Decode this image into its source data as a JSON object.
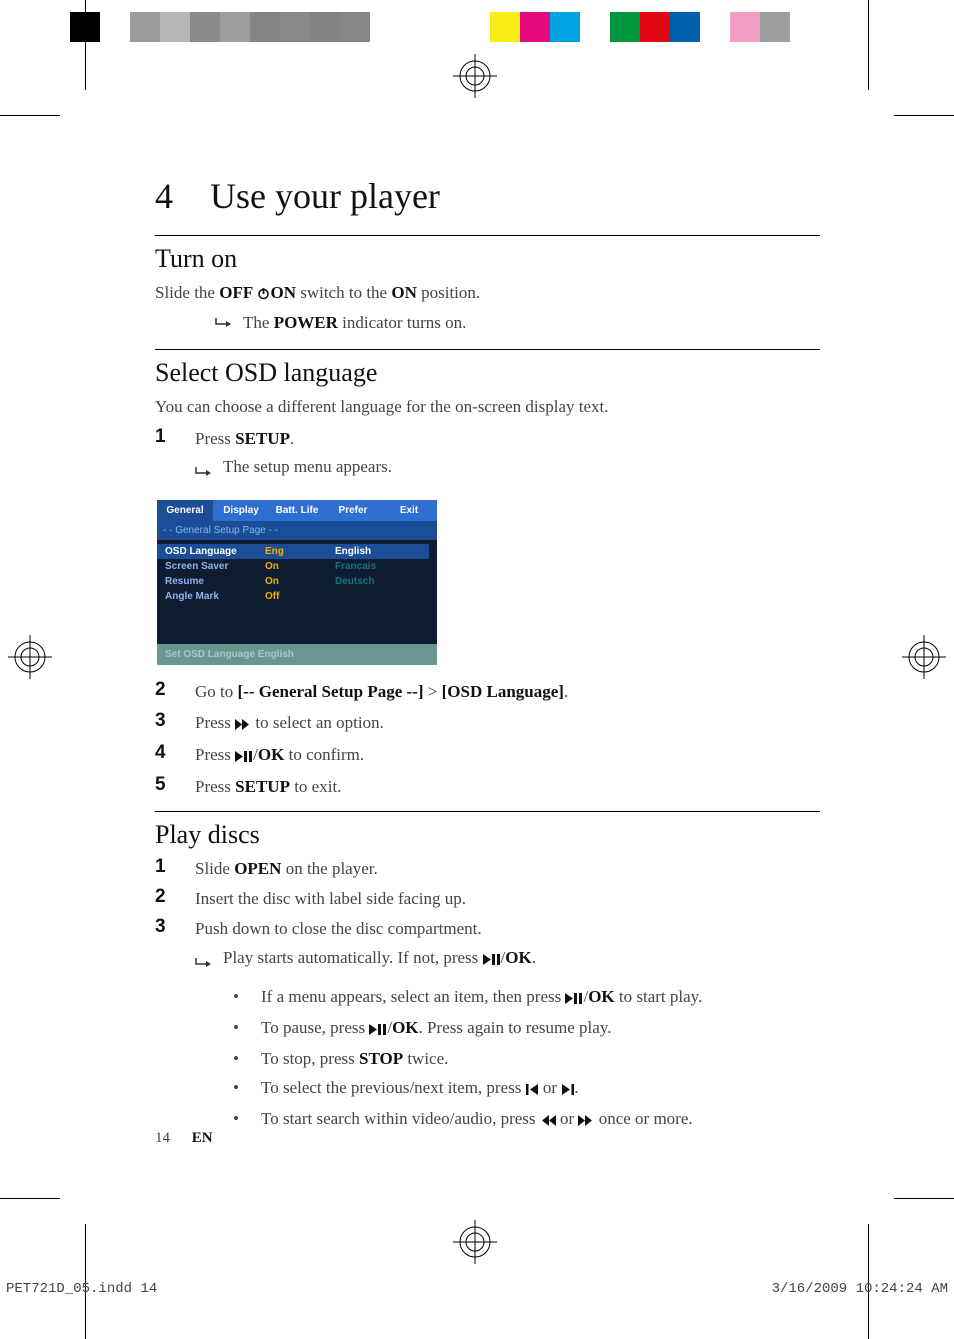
{
  "colorbar": [
    "#000000",
    "#ffffff",
    "#9b9b9b",
    "#b6b6b6",
    "#8b8b8b",
    "#9e9e9e",
    "#848484",
    "#888888",
    "#828282",
    "#868686",
    "#ffffff",
    "#ffffff",
    "#ffffff",
    "#ffffff",
    "#f7ec13",
    "#e4097f",
    "#00a3e2",
    "#ffffff",
    "#009640",
    "#e30613",
    "#0060ae",
    "#ffffff",
    "#f29ec4",
    "#9d9d9c",
    "#ffffff"
  ],
  "chapter": {
    "num": "4",
    "title": "Use your player"
  },
  "section1": {
    "heading": "Turn on",
    "line1_a": "Slide the ",
    "line1_b": "OFF",
    "line1_c": "ON",
    "line1_d": " switch to the ",
    "line1_e": "ON",
    "line1_f": " position.",
    "result_a": "The ",
    "result_b": "POWER",
    "result_c": " indicator turns on."
  },
  "section2": {
    "heading": "Select OSD language",
    "intro": "You can choose a different language for the on-screen display text.",
    "step1_a": "Press ",
    "step1_b": "SETUP",
    "step1_c": ".",
    "step1_result": "The setup menu appears.",
    "osd": {
      "tabs": [
        {
          "label": "General",
          "bg": "#1b4e97"
        },
        {
          "label": "Display",
          "bg": "#2f6fd1"
        },
        {
          "label": "Batt. Life",
          "bg": "#2f6fd1"
        },
        {
          "label": "Prefer",
          "bg": "#2f6fd1"
        },
        {
          "label": "Exit",
          "bg": "#2f6fd1"
        }
      ],
      "banner": "- -    General Setup Page   - -",
      "rows": [
        {
          "k": "OSD  Language",
          "v": "Eng",
          "sel": true,
          "kcolor": "#fff"
        },
        {
          "k": "Screen Saver",
          "v": "On",
          "kcolor": "#8cb4e8"
        },
        {
          "k": "Resume",
          "v": "On",
          "kcolor": "#8cb4e8"
        },
        {
          "k": "Angle Mark",
          "v": "Off",
          "kcolor": "#8cb4e8"
        }
      ],
      "right": [
        {
          "label": "English",
          "sel": true
        },
        {
          "label": "Francais"
        },
        {
          "label": "Deutsch"
        }
      ],
      "footer": "Set OSD Language English"
    },
    "step2_a": "Go to ",
    "step2_b": "[-- General Setup Page --]",
    "step2_c": " > ",
    "step2_d": "[OSD Language]",
    "step2_e": ".",
    "step3_a": "Press ",
    "step3_b": " to select an option.",
    "step4_a": "Press ",
    "step4_b": "/",
    "step4_c": "OK",
    "step4_d": " to confirm.",
    "step5_a": "Press ",
    "step5_b": "SETUP",
    "step5_c": " to exit."
  },
  "section3": {
    "heading": "Play discs",
    "step1_a": "Slide ",
    "step1_b": "OPEN",
    "step1_c": " on the player.",
    "step2": "Insert the disc with label side facing up.",
    "step3": "Push down to close the disc compartment.",
    "step3_result_a": "Play starts automatically. If not, press ",
    "step3_result_b": "/",
    "step3_result_c": "OK",
    "step3_result_d": ".",
    "bul1_a": "If a menu appears, select an item, then press ",
    "bul1_b": "/",
    "bul1_c": "OK",
    "bul1_d": " to start play.",
    "bul2_a": "To pause, press ",
    "bul2_b": "/",
    "bul2_c": "OK",
    "bul2_d": ". Press again to resume play.",
    "bul3_a": "To stop, press ",
    "bul3_b": "STOP",
    "bul3_c": " twice.",
    "bul4_a": "To select the previous/next item, press ",
    "bul4_b": " or ",
    "bul4_c": ".",
    "bul5_a": "To start search within video/audio, press ",
    "bul5_b": " or ",
    "bul5_c": " once or more."
  },
  "footer": {
    "page": "14",
    "lang": "EN"
  },
  "slug": {
    "file": "PET721D_05.indd   14",
    "stamp": "3/16/2009   10:24:24 AM"
  }
}
